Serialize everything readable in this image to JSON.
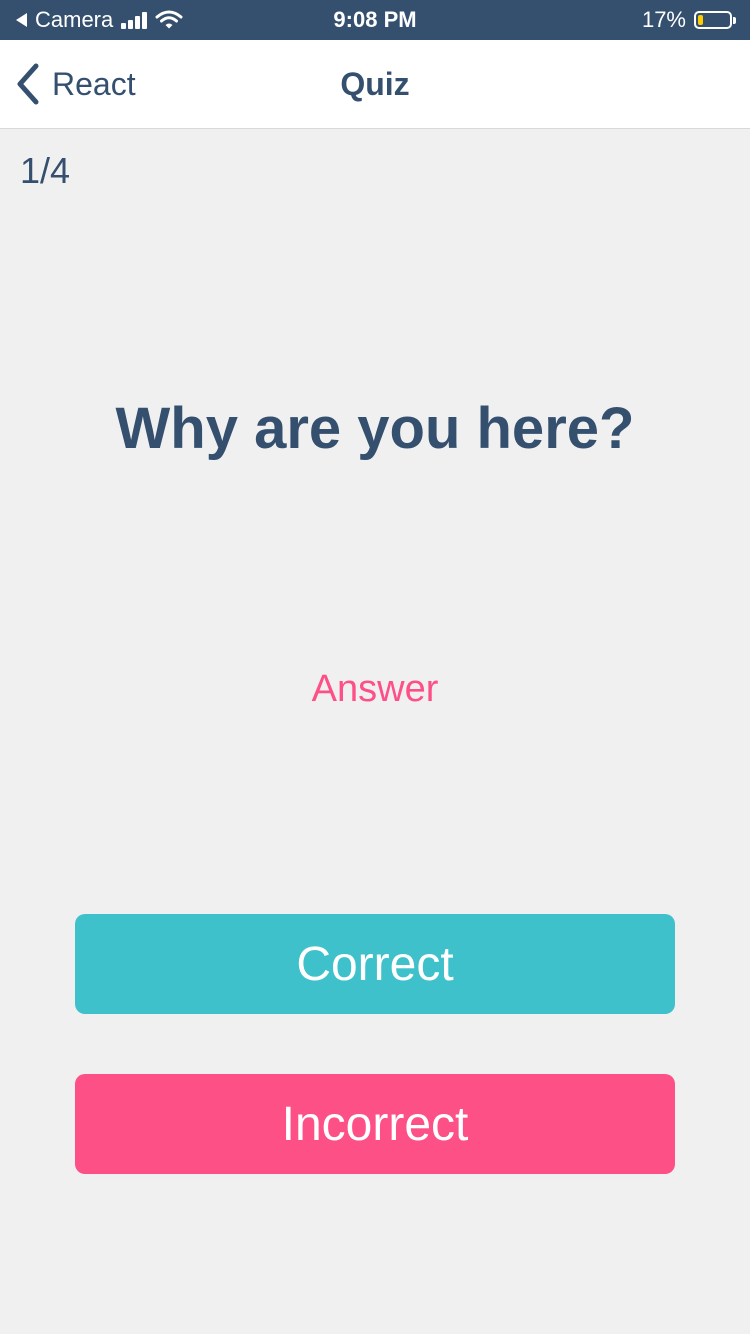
{
  "status_bar": {
    "back_app": "Camera",
    "time": "9:08 PM",
    "battery": "17%",
    "battery_level": 0.17,
    "icons": [
      "back-triangle-icon",
      "cellular-signal-icon",
      "wifi-icon",
      "battery-icon"
    ]
  },
  "nav": {
    "back_label": "React",
    "title": "Quiz",
    "back_icon": "chevron-left-icon"
  },
  "quiz": {
    "counter": "1/4",
    "question": "Why are you here?",
    "answer_label": "Answer"
  },
  "buttons": {
    "correct": "Correct",
    "incorrect": "Incorrect"
  },
  "colors": {
    "primary": "#34506e",
    "background": "#f0f0f0",
    "correct": "#3ec1cb",
    "incorrect": "#fd5087",
    "answer_text": "#fd5087",
    "battery_fill": "#ffcc00"
  }
}
